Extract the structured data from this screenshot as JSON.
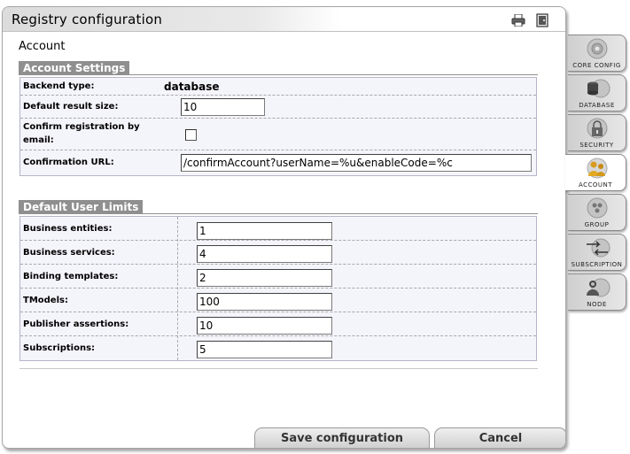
{
  "window": {
    "title": "Registry configuration"
  },
  "section": {
    "title": "Account"
  },
  "account_settings": {
    "header": "Account Settings",
    "backend_type": {
      "label": "Backend type:",
      "value": "database"
    },
    "default_result_size": {
      "label": "Default result size:",
      "value": "10"
    },
    "confirm_registration": {
      "label": "Confirm registration by email:",
      "checked": false
    },
    "confirmation_url": {
      "label": "Confirmation URL:",
      "value": "/confirmAccount?userName=%u&enableCode=%c"
    }
  },
  "user_limits": {
    "header": "Default User Limits",
    "rows": [
      {
        "label": "Business entities:",
        "value": "1"
      },
      {
        "label": "Business services:",
        "value": "4"
      },
      {
        "label": "Binding templates:",
        "value": "2"
      },
      {
        "label": "TModels:",
        "value": "100"
      },
      {
        "label": "Publisher assertions:",
        "value": "10"
      },
      {
        "label": "Subscriptions:",
        "value": "5"
      }
    ]
  },
  "buttons": {
    "save": "Save configuration",
    "cancel": "Cancel"
  },
  "tabs": [
    {
      "label": "CORE CONFIG",
      "icon": "core-config-icon",
      "active": false
    },
    {
      "label": "DATABASE",
      "icon": "database-icon",
      "active": false
    },
    {
      "label": "SECURITY",
      "icon": "security-icon",
      "active": false
    },
    {
      "label": "ACCOUNT",
      "icon": "account-icon",
      "active": true
    },
    {
      "label": "GROUP",
      "icon": "group-icon",
      "active": false
    },
    {
      "label": "SUBSCRIPTION",
      "icon": "subscription-icon",
      "active": false
    },
    {
      "label": "NODE",
      "icon": "node-icon",
      "active": false
    }
  ],
  "colors": {
    "header_gray": "#8f8f8f",
    "table_bg": "#f4f4fb",
    "account_accent": "#e2a820"
  }
}
